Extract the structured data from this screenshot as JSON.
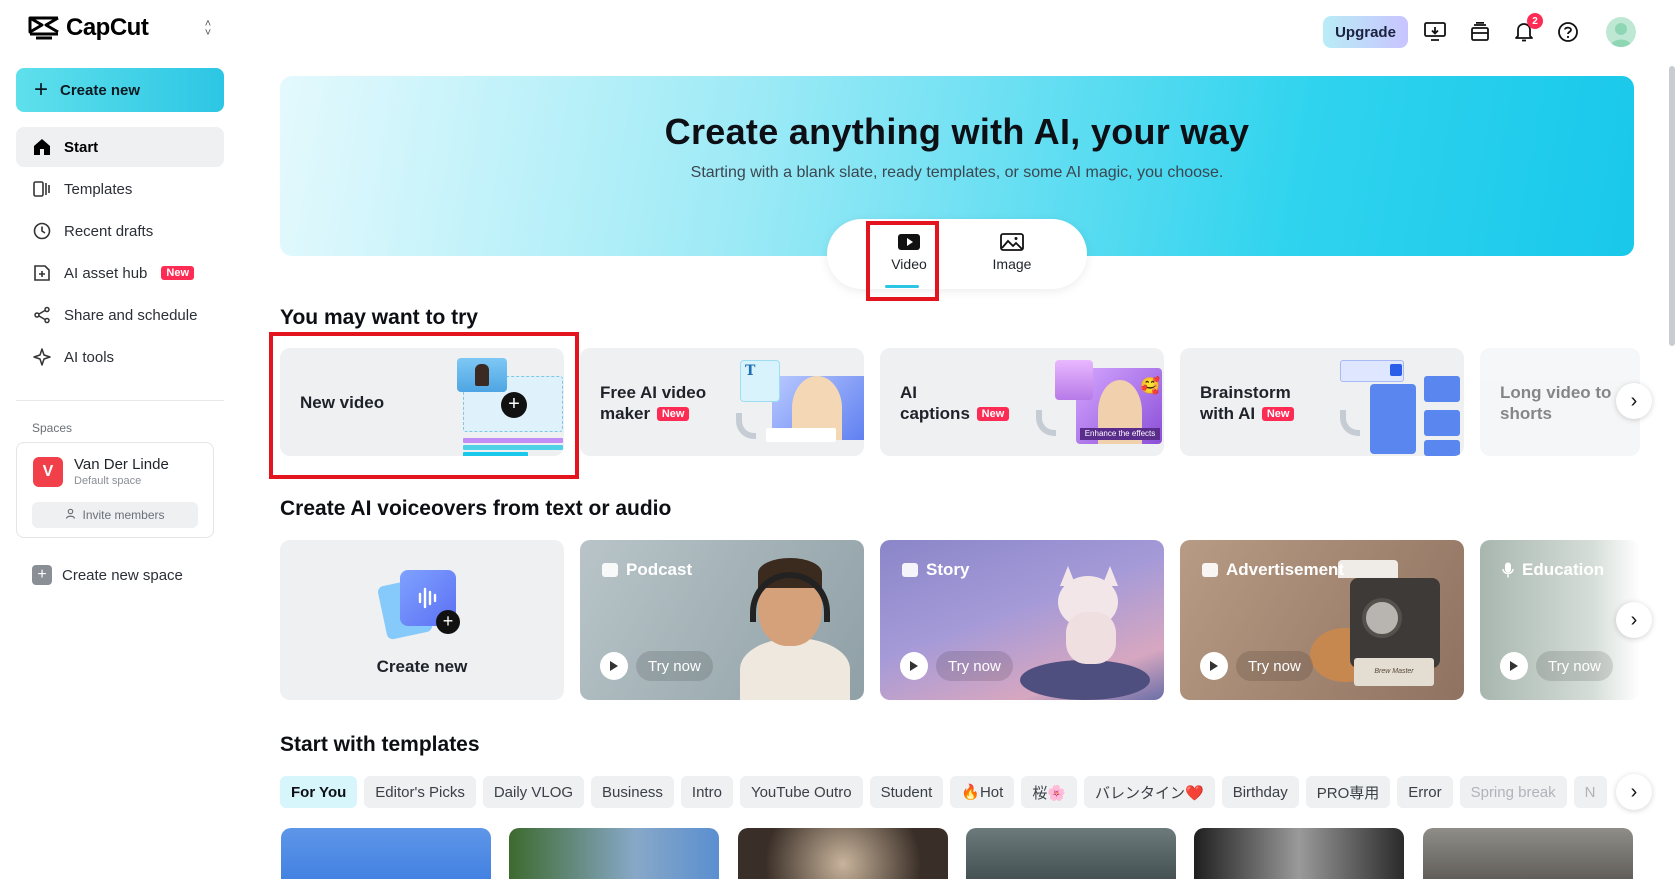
{
  "app": {
    "name": "CapCut"
  },
  "sidebar": {
    "create_label": "Create new",
    "items": [
      {
        "label": "Start",
        "icon": "home-icon",
        "active": true
      },
      {
        "label": "Templates",
        "icon": "templates-icon"
      },
      {
        "label": "Recent drafts",
        "icon": "clock-icon"
      },
      {
        "label": "AI asset hub",
        "icon": "asset-hub-icon",
        "badge": "New"
      },
      {
        "label": "Share and schedule",
        "icon": "share-icon"
      },
      {
        "label": "AI tools",
        "icon": "sparkle-icon"
      }
    ],
    "spaces_label": "Spaces",
    "space": {
      "initial": "V",
      "name": "Van Der Linde",
      "sub": "Default space",
      "invite_label": "Invite members"
    },
    "new_space_label": "Create new space"
  },
  "topbar": {
    "upgrade_label": "Upgrade",
    "notification_count": "2"
  },
  "hero": {
    "title": "Create anything with AI, your way",
    "subtitle": "Starting with a blank slate, ready templates, or some AI magic, you choose.",
    "tabs": [
      {
        "label": "Video",
        "active": true
      },
      {
        "label": "Image"
      }
    ]
  },
  "try_section": {
    "title": "You may want to try",
    "cards": [
      {
        "line1": "New video",
        "line2": "",
        "badge": ""
      },
      {
        "line1": "Free AI video",
        "line2": "maker",
        "badge": "New"
      },
      {
        "line1": "AI",
        "line2": "captions",
        "badge": "New"
      },
      {
        "line1": "Brainstorm",
        "line2": "with AI",
        "badge": "New"
      },
      {
        "line1": "Long video to",
        "line2": "shorts",
        "badge": ""
      }
    ],
    "caption_overlay": "Enhance the effects"
  },
  "voice_section": {
    "title": "Create AI voiceovers from text or audio",
    "create_label": "Create new",
    "cards": [
      {
        "label": "Podcast",
        "action": "Try now"
      },
      {
        "label": "Story",
        "action": "Try now"
      },
      {
        "label": "Advertisement",
        "action": "Try now"
      },
      {
        "label": "Education",
        "action": "Try now"
      }
    ],
    "machine_text": "Brew Master"
  },
  "templates_section": {
    "title": "Start with templates",
    "chips": [
      "For You",
      "Editor's Picks",
      "Daily VLOG",
      "Business",
      "Intro",
      "YouTube Outro",
      "Student",
      "🔥Hot",
      "桜🌸",
      "バレンタイン❤️",
      "Birthday",
      "PRO専用",
      "Error",
      "Spring break",
      "N"
    ]
  },
  "colors": {
    "accent": "#2cc6e4",
    "badge_red": "#fe2c55",
    "highlight_red": "#e3141e"
  }
}
